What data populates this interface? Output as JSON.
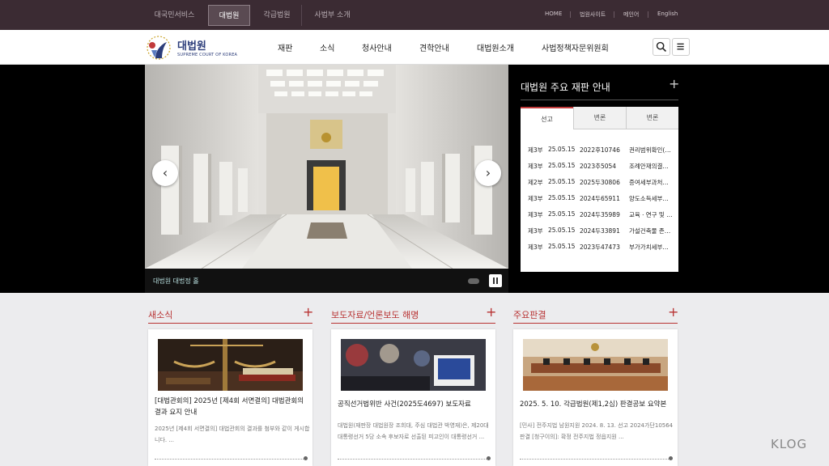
{
  "topbar": {
    "tabs": [
      "대국민서비스",
      "대법원",
      "각급법원",
      "사법부 소개"
    ],
    "utils": [
      "HOME",
      "법원사이트",
      "메인어",
      "English"
    ]
  },
  "header": {
    "logo_title": "대법원",
    "logo_sub": "SUPREME COURT OF KOREA",
    "nav": [
      "재판",
      "소식",
      "청사안내",
      "견학안내",
      "대법원소개",
      "사법정책자문위원회"
    ]
  },
  "hero": {
    "caption": "대법원 대법정 홀"
  },
  "trials": {
    "title": "대법원 주요 재판 안내",
    "tabs": [
      "선고",
      "변론",
      "변론"
    ],
    "rows": [
      {
        "dept": "제3부",
        "date": "25.05.15",
        "case": "2022후10746",
        "title": "권리범위확인(…"
      },
      {
        "dept": "제3부",
        "date": "25.05.15",
        "case": "2023추5054",
        "title": "조례안재의결…"
      },
      {
        "dept": "제2부",
        "date": "25.05.15",
        "case": "2025두30806",
        "title": "증여세부과처…"
      },
      {
        "dept": "제3부",
        "date": "25.05.15",
        "case": "2024두65911",
        "title": "양도소득세부…"
      },
      {
        "dept": "제3부",
        "date": "25.05.15",
        "case": "2024두35989",
        "title": "교육ㆍ연구 및 …"
      },
      {
        "dept": "제3부",
        "date": "25.05.15",
        "case": "2024두33891",
        "title": "가설건축물 존…"
      },
      {
        "dept": "제3부",
        "date": "25.05.15",
        "case": "2023두47473",
        "title": "부가가치세부…"
      }
    ]
  },
  "news": [
    {
      "heading": "새소식",
      "title": "[대법관회의] 2025년 [제4회 서면결의] 대법관회의 결과 요지 안내",
      "desc": "2025년 [제4회 서면결의] 대법관회의 결과를 첨부와 같이 게시합니다. ..."
    },
    {
      "heading": "보도자료/언론보도 해명",
      "title": "공직선거법위반 사건(2025도4697) 보도자료",
      "desc": "대법원(재판장 대법원장 조희대, 주심 대법관 박영재)은, 제20대 대통령선거 5당 소속 후보자로 선출된 피고인이 대통령선거 ..."
    },
    {
      "heading": "주요판결",
      "title": "2025. 5. 10. 각급법원(제1,2심) 판결공보 요약본",
      "desc": "[민사] 전주지법 남원지원 2024. 8. 13. 선고 2024가단10564 판결 [청구이의]: 확정 전주지법 정읍지원 ..."
    }
  ],
  "watermark": "KLOG",
  "colors": {
    "accent": "#b83232",
    "topbar": "#3b2b33",
    "brand": "#2c3d7a"
  }
}
